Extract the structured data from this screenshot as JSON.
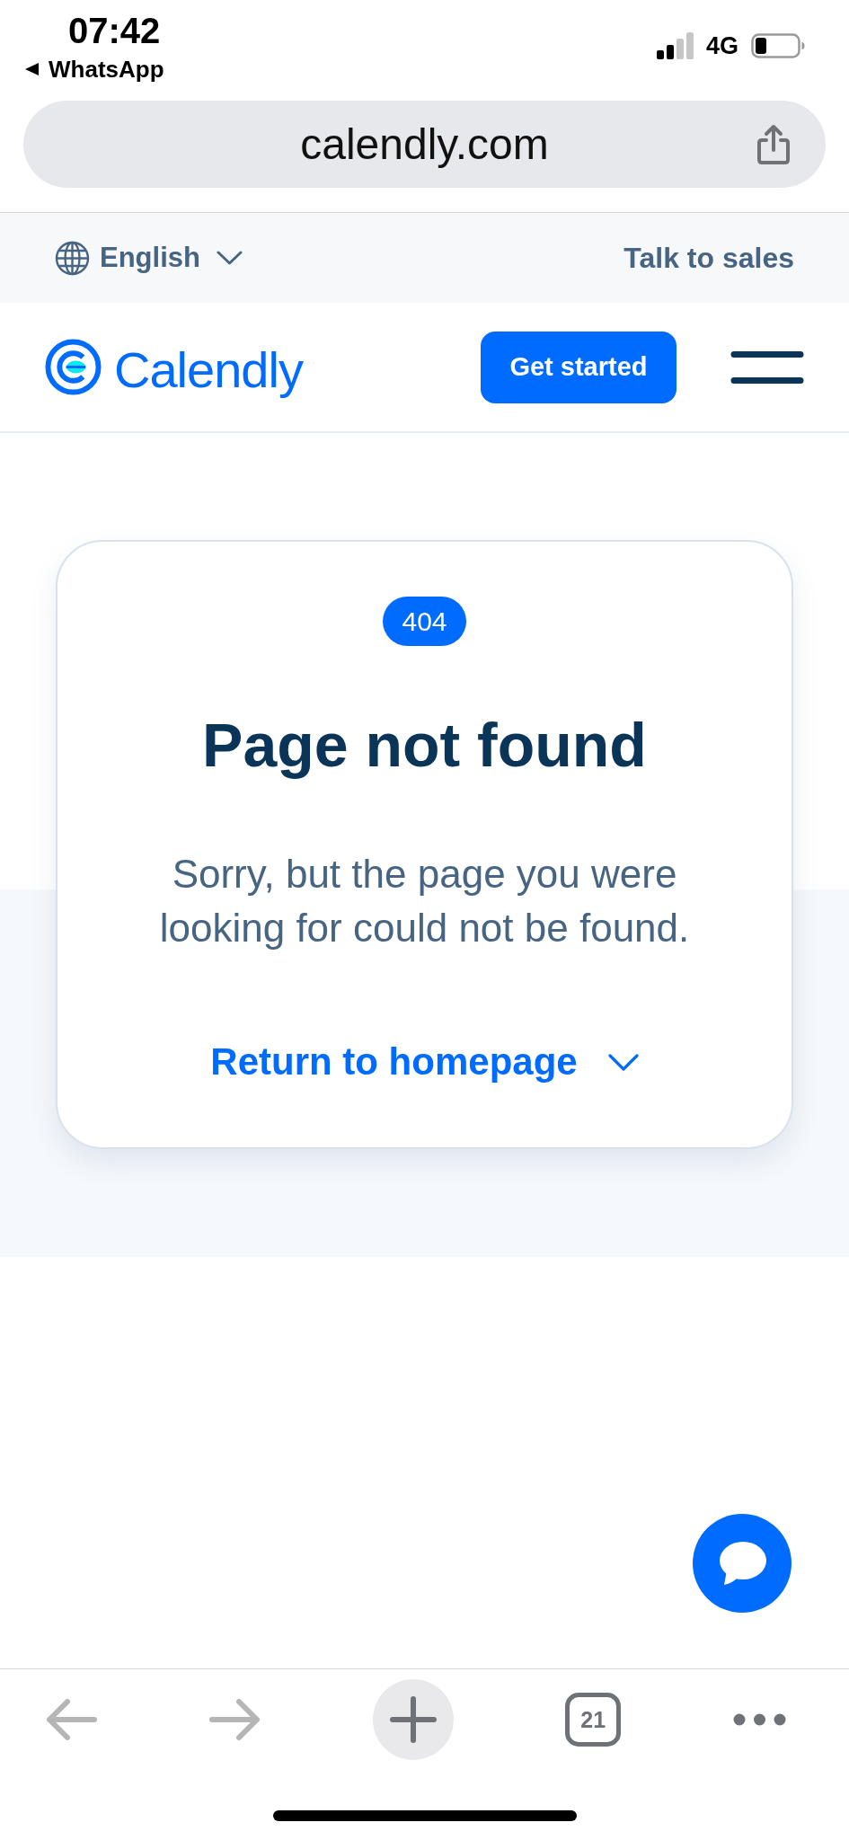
{
  "status_bar": {
    "time": "07:42",
    "back_app": "WhatsApp",
    "network": "4G"
  },
  "address_bar": {
    "url": "calendly.com"
  },
  "utility_bar": {
    "language": "English",
    "sales_link": "Talk to sales"
  },
  "header": {
    "logo_text": "Calendly",
    "cta": "Get started"
  },
  "error_card": {
    "badge": "404",
    "title": "Page not found",
    "message": "Sorry, but the page you were looking for could not be found.",
    "link": "Return to homepage"
  },
  "browser_toolbar": {
    "back": {
      "disabled": true
    },
    "forward": {
      "disabled": true
    },
    "tab_count": "21"
  }
}
